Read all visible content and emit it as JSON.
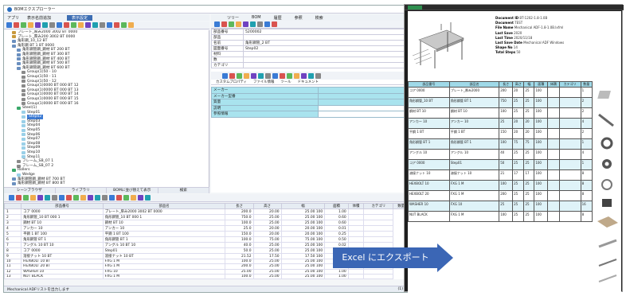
{
  "window": {
    "title": "BOMエクスプローラー"
  },
  "menu": {
    "items": [
      "アプリ",
      "表示名前追加",
      "",
      "表示設定"
    ],
    "active_index": 3
  },
  "right_menu": {
    "items": [
      "ツリー",
      "BOM",
      "履歴",
      "参照",
      "検索"
    ]
  },
  "tree": {
    "rows": [
      {
        "indent": 1,
        "text": "プレート_厚み2000 3002 BT 0000",
        "color": "#c99a3c"
      },
      {
        "indent": 1,
        "text": "プレート_厚み200 3002 BT 0000",
        "color": "#c99a3c"
      },
      {
        "indent": 1,
        "text": "角形鋼_10_12 BT",
        "color": "#6a8fbf"
      },
      {
        "indent": 1,
        "text": "角形鋼 BT 1 BT 0000",
        "color": "#6a8fbf"
      },
      {
        "indent": 2,
        "text": "角形鋼管鋼_鋼材 BT 200 BT",
        "color": "#6a8fbf"
      },
      {
        "indent": 2,
        "text": "角形鋼管鋼_鋼材 BT 300 BT",
        "color": "#6a8fbf"
      },
      {
        "indent": 2,
        "text": "角形鋼管鋼_鋼材 BT 400 BT",
        "color": "#6a8fbf"
      },
      {
        "indent": 2,
        "text": "角形鋼管鋼_鋼材 BT 500 BT",
        "color": "#6a8fbf"
      },
      {
        "indent": 2,
        "text": "角形鋼管鋼_鋼材 BT 600 BT",
        "color": "#6a8fbf"
      },
      {
        "indent": 3,
        "text": "Group(1)50 - 10",
        "color": "#8a8a8a"
      },
      {
        "indent": 3,
        "text": "Group(1)50 - 11",
        "color": "#8a8a8a"
      },
      {
        "indent": 3,
        "text": "Group(1)50 - 12",
        "color": "#8a8a8a"
      },
      {
        "indent": 3,
        "text": "Group(1)0000 BT 000 BT 12",
        "color": "#8a8a8a"
      },
      {
        "indent": 3,
        "text": "Group(1)0000 BT 000 BT 13",
        "color": "#8a8a8a"
      },
      {
        "indent": 3,
        "text": "Group(1)0000 BT 000 BT 14",
        "color": "#8a8a8a"
      },
      {
        "indent": 3,
        "text": "Group(1)0000 BT 000 BT 15",
        "color": "#8a8a8a"
      },
      {
        "indent": 3,
        "text": "Group(1)0000 BT 000 BT 16",
        "color": "#8a8a8a"
      },
      {
        "indent": 2,
        "text": "Steel(1)",
        "color": "#3aa86a"
      },
      {
        "indent": 3,
        "text": "Step01",
        "color": "#9ad0e8"
      },
      {
        "indent": 3,
        "text": "Step02",
        "color": "#9ad0e8",
        "selected": true
      },
      {
        "indent": 3,
        "text": "Step03",
        "color": "#9ad0e8"
      },
      {
        "indent": 3,
        "text": "Step04",
        "color": "#9ad0e8"
      },
      {
        "indent": 3,
        "text": "Step05",
        "color": "#9ad0e8"
      },
      {
        "indent": 3,
        "text": "Step06",
        "color": "#9ad0e8"
      },
      {
        "indent": 3,
        "text": "Step07",
        "color": "#9ad0e8"
      },
      {
        "indent": 3,
        "text": "Step08",
        "color": "#9ad0e8"
      },
      {
        "indent": 3,
        "text": "Step09",
        "color": "#9ad0e8"
      },
      {
        "indent": 3,
        "text": "Step10",
        "color": "#9ad0e8"
      },
      {
        "indent": 3,
        "text": "Step11",
        "color": "#9ad0e8"
      },
      {
        "indent": 2,
        "text": "フレーム_SB_07 1",
        "color": "#8a8a8a"
      },
      {
        "indent": 2,
        "text": "フレーム_SB_07 2",
        "color": "#8a8a8a"
      },
      {
        "indent": 1,
        "text": "Rollers",
        "color": "#3aa86a"
      },
      {
        "indent": 2,
        "text": "Wedge",
        "color": "#9ad0e8"
      },
      {
        "indent": 1,
        "text": "角形鋼管鋼_鋼材 BT 700 BT",
        "color": "#6a8fbf"
      },
      {
        "indent": 1,
        "text": "角形鋼管鋼_鋼材 BT 800 BT",
        "color": "#6a8fbf"
      }
    ]
  },
  "left_tabs": [
    "シーンブラウザ",
    "ライブラリ",
    "BOMに並び替えて表示",
    "検索"
  ],
  "properties": {
    "rows": [
      {
        "label": "部品番号",
        "value": "5200002"
      },
      {
        "label": "部品",
        "value": ""
      },
      {
        "label": "名前",
        "value": "角形鋼管_2 BT"
      },
      {
        "label": "図面番号",
        "value": "Step02"
      },
      {
        "label": "材料",
        "value": ""
      },
      {
        "label": "数",
        "value": ""
      },
      {
        "label": "カテゴリ",
        "value": ""
      }
    ]
  },
  "subtabs": [
    "カスタムプロパティ",
    "ファイル情報",
    "ツール",
    "ドキュメント"
  ],
  "custom_props": [
    "メーカー",
    "メーカー型番",
    "質量",
    "説明",
    "参照情報"
  ],
  "bom": {
    "columns": [
      "",
      "部品番号",
      "部品名",
      "長さ",
      "高さ",
      "幅",
      "面積",
      "体積",
      "カテゴリ",
      "数量"
    ],
    "rows": [
      [
        "1",
        "コア 0000",
        "プレート_厚み2000 3002 BT 0000",
        "200.0",
        "20.00",
        "25.00 100",
        "1.00",
        "",
        ""
      ],
      [
        "2",
        "角形鋼管_10 BT 000 1",
        "角形鋼管_10 BT 000 1",
        "750.0",
        "25.00",
        "25.00 100",
        "0.60",
        "",
        ""
      ],
      [
        "3",
        "鋼材 BT 10",
        "鋼材 BT 10",
        "100.0",
        "25.00",
        "25.00 100",
        "0.60",
        "",
        ""
      ],
      [
        "4",
        "アンカー 10",
        "アンカー 10",
        "25.0",
        "20.00",
        "20.00 100",
        "0.01",
        "",
        ""
      ],
      [
        "5",
        "平鋼 1 BT 100",
        "平鋼 1 BT 100",
        "150.0",
        "20.00",
        "20.00 100",
        "0.25",
        "",
        ""
      ],
      [
        "6",
        "角形鋼管 BT 1",
        "角形鋼管 BT 1",
        "100.0",
        "75.00",
        "75.00 100",
        "0.50",
        "",
        ""
      ],
      [
        "7",
        "アングル 10 BT 10",
        "アングル 10 BT 10",
        "40.0",
        "25.00",
        "25.00 100",
        "0.02",
        "",
        ""
      ],
      [
        "8",
        "コア 0000",
        "Step01",
        "50.0",
        "25.00",
        "25.00 100",
        "1.00",
        "",
        ""
      ],
      [
        "9",
        "溶接ナット 10 BT",
        "溶接ナット 10 BT",
        "21.52",
        "17.50",
        "17.50 100",
        "1.00",
        "",
        ""
      ],
      [
        "10",
        "HEXBOLT 10 BT",
        "FXG 1 M",
        "100.0",
        "25.00",
        "25.00 100",
        "1.00",
        "",
        ""
      ],
      [
        "11",
        "HEXBOLT 20 BT",
        "FXG 1 M",
        "200.0",
        "25.00",
        "25.00 100",
        "1.00",
        "",
        ""
      ],
      [
        "12",
        "WASHER 10",
        "FXG 10",
        "25.00",
        "25.00",
        "25.00 100",
        "1.00",
        "",
        ""
      ],
      [
        "13",
        "NUT BLACK",
        "FXG 1 M",
        "100.0",
        "25.00",
        "25.00 100",
        "1.00",
        "",
        ""
      ]
    ]
  },
  "status": {
    "left": "Mechanical ADFリストを出力します",
    "right": "(1)  (2)"
  },
  "excel": {
    "meta": [
      {
        "k": "Document ID",
        "v": "BT-1202-1.8-1.0B"
      },
      {
        "k": "Document",
        "v": "TEST"
      },
      {
        "k": "File Name",
        "v": "Mechanical ADF-1.8-1.0B.lxfml"
      },
      {
        "k": "Last Save",
        "v": "2020"
      },
      {
        "k": "Last Time",
        "v": "2020/11/18"
      },
      {
        "k": "Last Save Date",
        "v": "Mechanical ADF Windows"
      },
      {
        "k": "Shape No",
        "v": "14"
      },
      {
        "k": "Total Steps",
        "v": "50"
      }
    ],
    "headers": [
      "部品番号",
      "部品名",
      "長さ",
      "高さ",
      "幅",
      "面積",
      "体積",
      "カテゴリ",
      "数量"
    ],
    "rows": [
      [
        "コア 0000",
        "プレート_厚み2000",
        "200",
        "20",
        "25",
        "100",
        "",
        "",
        "1"
      ],
      [
        "角形鋼管_10 BT",
        "角形鋼管 BT 1",
        "750",
        "25",
        "25",
        "100",
        "",
        "",
        "2"
      ],
      [
        "鋼材 BT 10",
        "鋼材 BT 10",
        "100",
        "25",
        "25",
        "100",
        "",
        "",
        "2"
      ],
      [
        "アンカー 10",
        "アンカー 10",
        "25",
        "20",
        "20",
        "100",
        "",
        "",
        "4"
      ],
      [
        "平鋼 1 BT",
        "平鋼 1 BT",
        "150",
        "20",
        "20",
        "100",
        "",
        "",
        "2"
      ],
      [
        "角形鋼管 BT 1",
        "角形鋼管 BT 1",
        "100",
        "75",
        "75",
        "100",
        "",
        "",
        "1"
      ],
      [
        "アングル 10",
        "アングル 10",
        "40",
        "25",
        "25",
        "100",
        "",
        "",
        "4"
      ],
      [
        "コア 0000",
        "Step01",
        "50",
        "25",
        "25",
        "100",
        "",
        "",
        "1"
      ],
      [
        "溶接ナット 10",
        "溶接ナット 10",
        "21",
        "17",
        "17",
        "100",
        "",
        "",
        "8"
      ],
      [
        "HEXBOLT 10",
        "FXG 1 M",
        "100",
        "25",
        "25",
        "100",
        "",
        "",
        "8"
      ],
      [
        "HEXBOLT 20",
        "FXG 1 M",
        "200",
        "25",
        "25",
        "100",
        "",
        "",
        "8"
      ],
      [
        "WASHER 10",
        "FXG 10",
        "25",
        "25",
        "25",
        "100",
        "",
        "",
        "16"
      ],
      [
        "NUT BLACK",
        "FXG 1 M",
        "100",
        "25",
        "25",
        "100",
        "",
        "",
        "8"
      ]
    ]
  },
  "arrow": {
    "label": "Excel にエクスポート",
    "color": "#3b66b5"
  }
}
